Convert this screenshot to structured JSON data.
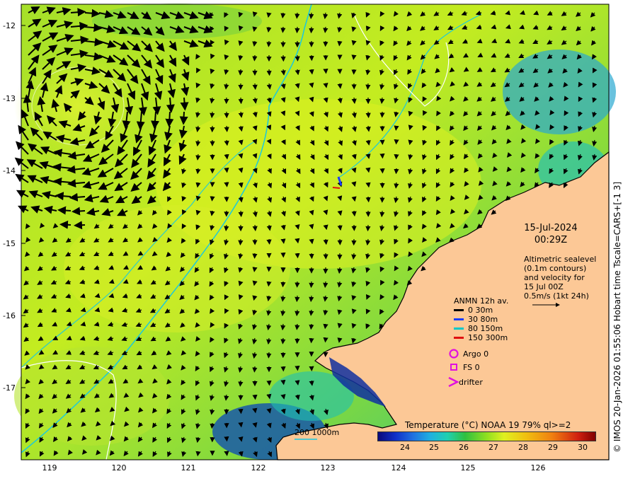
{
  "map": {
    "y_axis_labels": [
      "-12",
      "-13",
      "-14",
      "-15",
      "-16",
      "-17"
    ],
    "x_axis_labels": [
      "119",
      "120",
      "121",
      "122",
      "123",
      "124",
      "125",
      "126"
    ],
    "date": "15-Jul-2024",
    "time": "00:29Z",
    "altimetry_lines": [
      "Altimetric sealevel",
      "(0.1m contours)",
      "and velocity for",
      "15 Jul 00Z",
      "0.5m/s (1kt 24h)"
    ],
    "legend": {
      "title": "ANMN 12h av.",
      "items": [
        {
          "label": "0 30m",
          "color": "#000000"
        },
        {
          "label": "30 80m",
          "color": "#1a3cff"
        },
        {
          "label": "80 150m",
          "color": "#00c8c8"
        },
        {
          "label": "150 300m",
          "color": "#e01010"
        }
      ]
    },
    "argo_label": "Argo 0",
    "fs_label": "FS 0",
    "drifter_label": "drifter",
    "depth_scale_label": "200  1000m",
    "colorbar_title": "Temperature (°C) NOAA 19 79% ql>=2",
    "colorbar_ticks": [
      "24",
      "25",
      "26",
      "27",
      "28",
      "29",
      "30"
    ],
    "credit": "© IMOS 20-Jan-2026 01:55:06 Hobart time Tscale=CARS+[-1 3]"
  }
}
